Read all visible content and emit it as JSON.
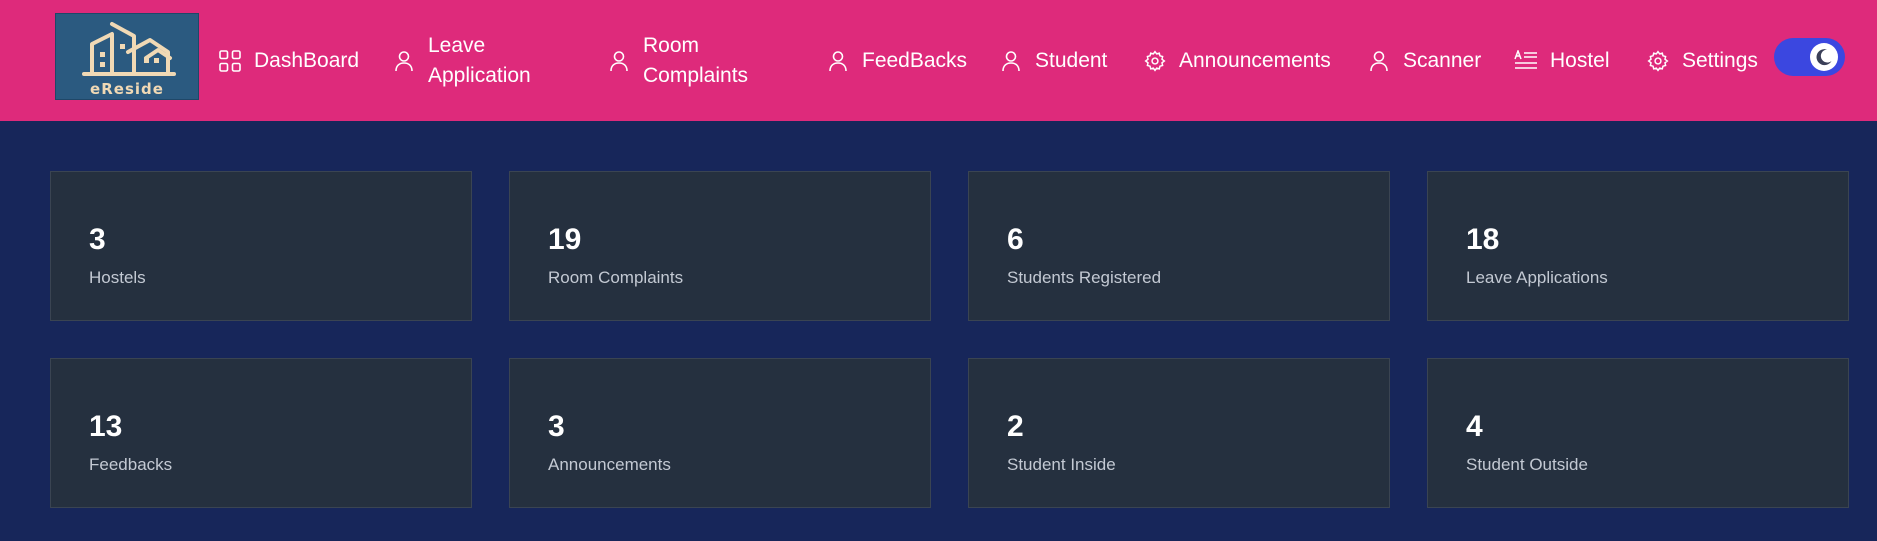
{
  "brand": {
    "logo_text": "eReside"
  },
  "nav": {
    "dashboard": "DashBoard",
    "leave_application": "Leave\nApplication",
    "room_complaints": "Room\nComplaints",
    "feedbacks": "FeedBacks",
    "student": "Student",
    "announcements": "Announcements",
    "scanner": "Scanner",
    "hostel": "Hostel",
    "settings": "Settings"
  },
  "theme_toggle": {
    "mode": "dark",
    "icon": "moon-icon"
  },
  "stats": [
    {
      "value": "3",
      "label": "Hostels"
    },
    {
      "value": "19",
      "label": "Room Complaints"
    },
    {
      "value": "6",
      "label": "Students Registered"
    },
    {
      "value": "18",
      "label": "Leave Applications"
    },
    {
      "value": "13",
      "label": "Feedbacks"
    },
    {
      "value": "3",
      "label": "Announcements"
    },
    {
      "value": "2",
      "label": "Student Inside"
    },
    {
      "value": "4",
      "label": "Student Outside"
    }
  ],
  "colors": {
    "navbar": "#de2a7b",
    "background": "#17265a",
    "card": "#25303f",
    "toggle": "#3b47e0"
  }
}
